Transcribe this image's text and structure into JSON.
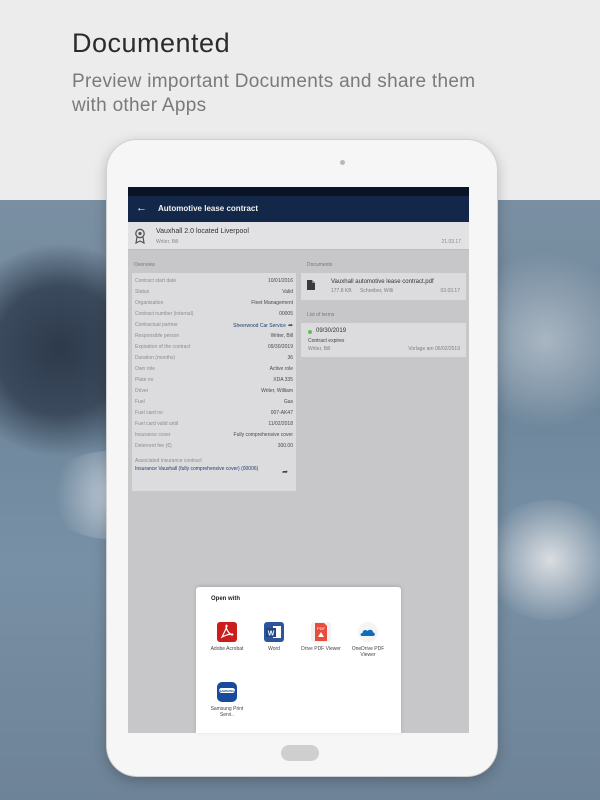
{
  "hero": {
    "title": "Documented",
    "subtitle": "Preview important Documents and share them with other Apps"
  },
  "appbar": {
    "title": "Automotive lease contract"
  },
  "header_card": {
    "title": "Vauxhall 2.0 located Liverpool",
    "subtitle": "Writer, Bill",
    "date": "21.03.17"
  },
  "overview": {
    "label": "Overview",
    "rows": [
      {
        "key": "Contract start date",
        "value": "10/01/2016"
      },
      {
        "key": "Status",
        "value": "Valid"
      },
      {
        "key": "Organization",
        "value": "Fleet Management"
      },
      {
        "key": "Contract number (internal)",
        "value": "00005"
      },
      {
        "key": "Contractual partner",
        "value": "Sheerwood Car Service"
      },
      {
        "key": "Responsible person",
        "value": "Writer, Bill"
      },
      {
        "key": "Expiration of the contract",
        "value": "09/30/2019"
      },
      {
        "key": "Duration (months)",
        "value": "36"
      },
      {
        "key": "Own role",
        "value": "Active role"
      },
      {
        "key": "Plate no",
        "value": "XDA 335"
      },
      {
        "key": "Driver",
        "value": "Writer, William"
      },
      {
        "key": "Fuel",
        "value": "Gas"
      },
      {
        "key": "Fuel card no",
        "value": "007-AK47"
      },
      {
        "key": "Fuel card valid until",
        "value": "11/02/2018"
      },
      {
        "key": "Insurance cover",
        "value": "Fully comprehensive cover"
      },
      {
        "key": "Deterrent fee (€)",
        "value": "300.00"
      }
    ],
    "insurance_label": "Associated insurance contract",
    "insurance_value": "Insurance Vauxhall (fully comprehensive cover) (00006)"
  },
  "documents": {
    "label": "Documents",
    "item": {
      "name": "Vauxhall automotive lease contract.pdf",
      "size": "177.8 KB",
      "author": "Schreiber, Willi",
      "date": "03.03.17"
    }
  },
  "terms": {
    "label": "List of terms",
    "item": {
      "date": "09/30/2019",
      "title": "Contract expires",
      "person": "Writer, Bill",
      "due": "Vorlage am 06/02/2019"
    }
  },
  "sheet": {
    "title": "Open with",
    "apps": [
      {
        "label": "Adobe Acrobat",
        "icon": "adobe-acrobat-icon",
        "color": "#cc1d1d"
      },
      {
        "label": "Word",
        "icon": "word-icon",
        "color": "#2b579a"
      },
      {
        "label": "Drive PDF Viewer",
        "icon": "drive-pdf-icon",
        "color": "#e94b3c"
      },
      {
        "label": "OneDrive PDF Viewer",
        "icon": "onedrive-icon",
        "color": "#0f6cbd"
      },
      {
        "label": "Samsung Print Servi..",
        "icon": "samsung-print-icon",
        "color": "#1a4a9c"
      }
    ]
  },
  "colors": {
    "appbar": "#132748",
    "status_dot": "#5fc24a",
    "link": "#1f3e6e"
  }
}
